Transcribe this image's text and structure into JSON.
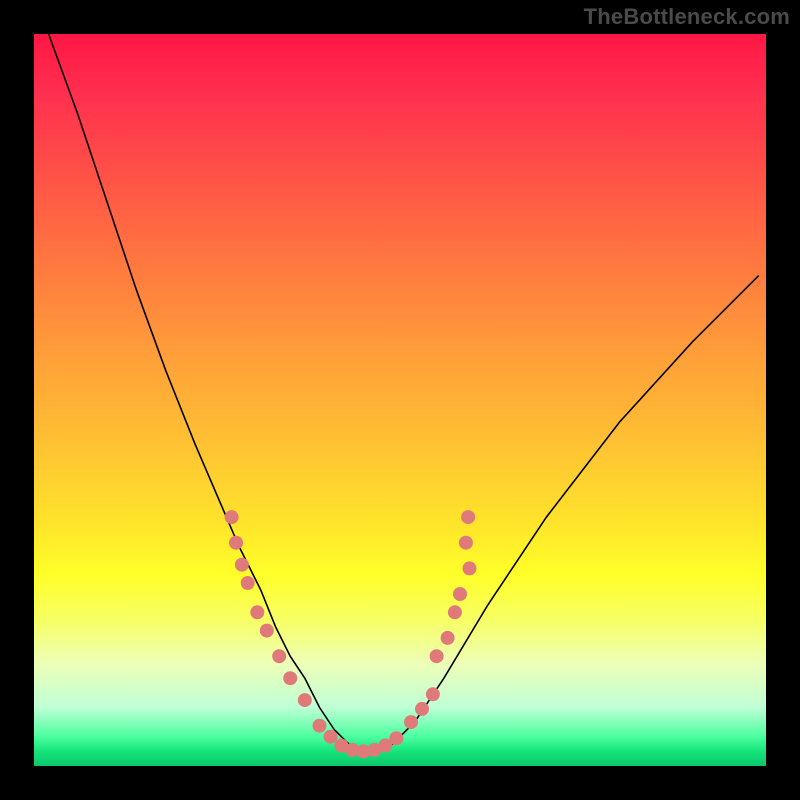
{
  "watermark": "TheBottleneck.com",
  "chart_data": {
    "type": "line",
    "title": "",
    "xlabel": "",
    "ylabel": "",
    "xlim": [
      0,
      100
    ],
    "ylim": [
      0,
      100
    ],
    "grid": false,
    "legend": false,
    "gradient_colors": {
      "top": "#ff1744",
      "middle": "#ffe12b",
      "bottom": "#14e47a"
    },
    "curve": {
      "x": [
        2,
        6,
        10,
        14,
        18,
        22,
        25,
        28,
        31,
        33,
        35,
        37,
        39,
        41,
        43,
        45,
        47,
        49,
        52,
        56,
        62,
        70,
        80,
        90,
        99
      ],
      "y": [
        100,
        89,
        77,
        65,
        54,
        44,
        37,
        30,
        24,
        19,
        15,
        12,
        8,
        5,
        3,
        2,
        2,
        3,
        6,
        12,
        22,
        34,
        47,
        58,
        67
      ]
    },
    "markers": [
      {
        "x": 27.0,
        "y": 34.0
      },
      {
        "x": 27.6,
        "y": 30.5
      },
      {
        "x": 28.4,
        "y": 27.5
      },
      {
        "x": 29.2,
        "y": 25.0
      },
      {
        "x": 30.5,
        "y": 21.0
      },
      {
        "x": 31.8,
        "y": 18.5
      },
      {
        "x": 33.5,
        "y": 15.0
      },
      {
        "x": 35.0,
        "y": 12.0
      },
      {
        "x": 37.0,
        "y": 9.0
      },
      {
        "x": 39.0,
        "y": 5.5
      },
      {
        "x": 40.5,
        "y": 4.0
      },
      {
        "x": 42.0,
        "y": 2.8
      },
      {
        "x": 43.5,
        "y": 2.2
      },
      {
        "x": 45.0,
        "y": 2.0
      },
      {
        "x": 46.5,
        "y": 2.2
      },
      {
        "x": 48.0,
        "y": 2.8
      },
      {
        "x": 49.5,
        "y": 3.8
      },
      {
        "x": 51.5,
        "y": 6.0
      },
      {
        "x": 53.0,
        "y": 7.8
      },
      {
        "x": 54.5,
        "y": 9.8
      },
      {
        "x": 55.0,
        "y": 15.0
      },
      {
        "x": 56.5,
        "y": 17.5
      },
      {
        "x": 57.5,
        "y": 21.0
      },
      {
        "x": 58.2,
        "y": 23.5
      },
      {
        "x": 59.5,
        "y": 27.0
      },
      {
        "x": 59.0,
        "y": 30.5
      },
      {
        "x": 59.3,
        "y": 34.0
      }
    ]
  }
}
